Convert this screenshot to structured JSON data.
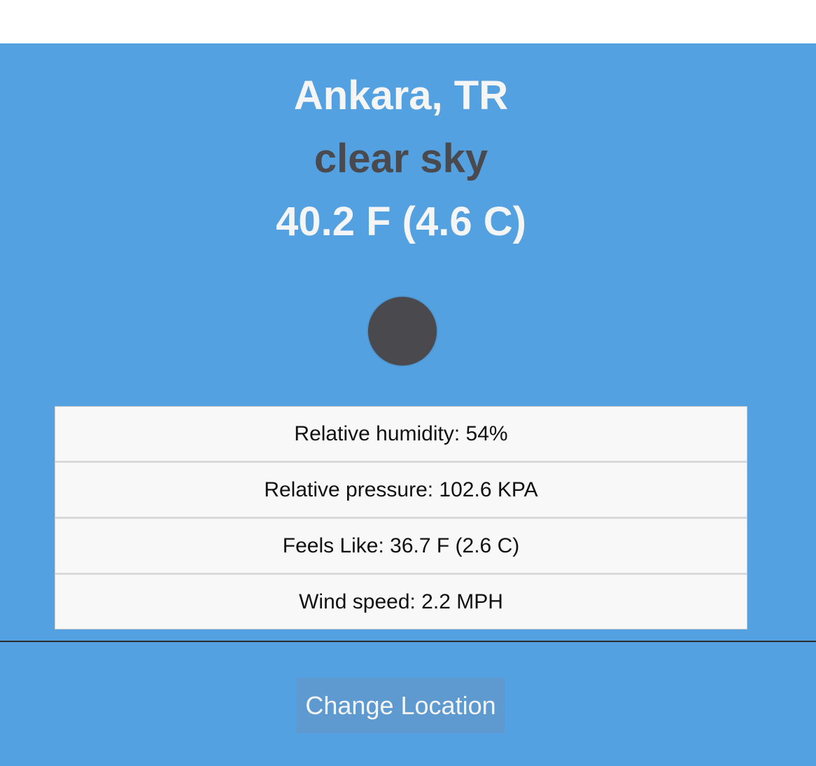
{
  "weather": {
    "location": "Ankara, TR",
    "description": "clear sky",
    "temperature": "40.2 F (4.6 C)",
    "icon": "clear-sky-circle-icon",
    "details": [
      {
        "label": "Relative humidity: 54%"
      },
      {
        "label": "Relative pressure: 102.6 KPA"
      },
      {
        "label": "Feels Like: 36.7 F (2.6 C)"
      },
      {
        "label": "Wind speed: 2.2 MPH"
      }
    ]
  },
  "actions": {
    "change_location_label": "Change Location"
  },
  "colors": {
    "panel_background": "#53a1e0",
    "heading_light": "#f5f5f5",
    "heading_dark": "#4a4a4e",
    "button_background": "#5e9ad0"
  }
}
